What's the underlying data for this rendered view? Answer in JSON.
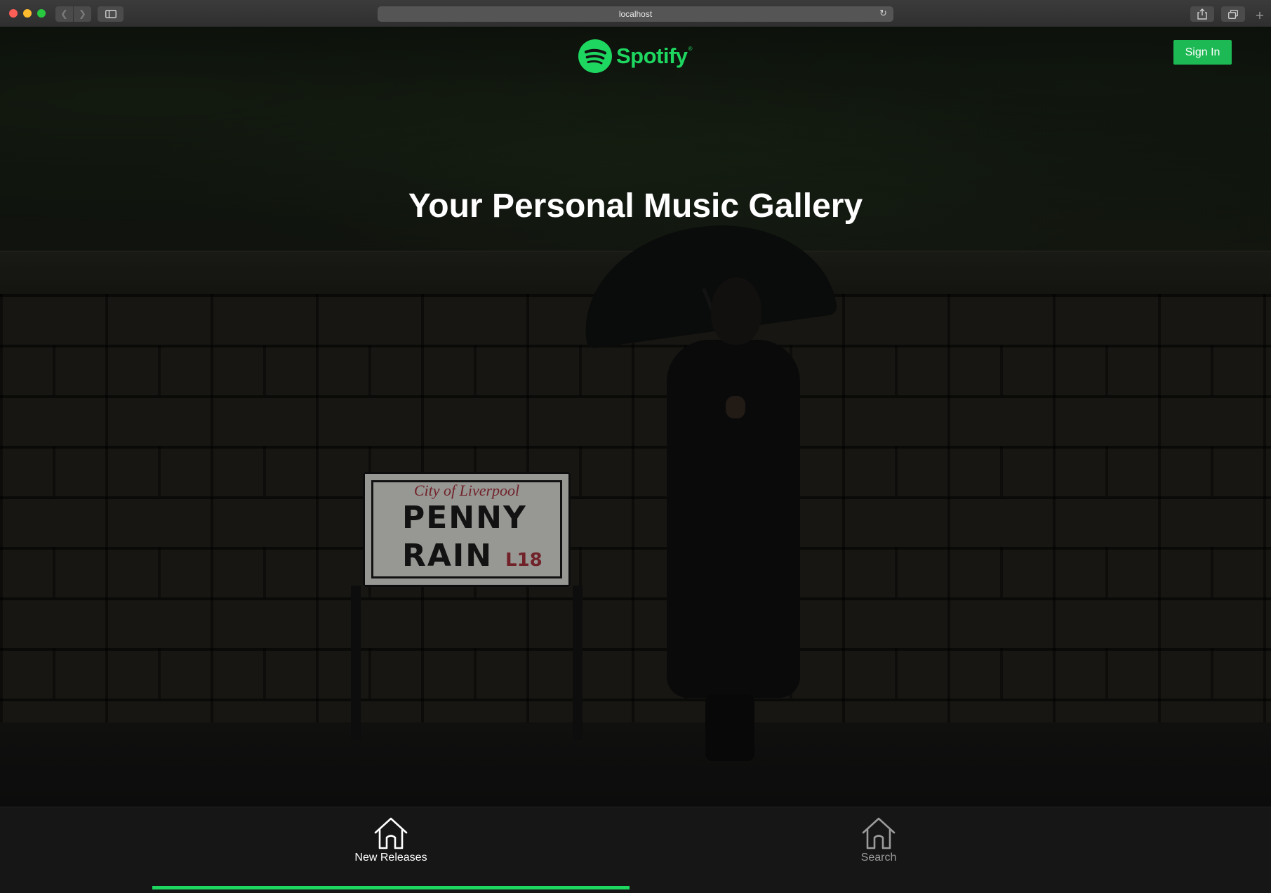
{
  "browser": {
    "url": "localhost",
    "new_tab_glyph": "+",
    "icons": [
      "back-arrow-icon",
      "forward-arrow-icon",
      "sidebar-icon",
      "reload-icon",
      "share-icon",
      "tabs-icon",
      "new-tab-icon"
    ]
  },
  "header": {
    "brand_name": "Spotify",
    "brand_mark": "®",
    "brand_color": "#1ed760",
    "signin_label": "Sign In",
    "signin_color": "#1db954"
  },
  "hero": {
    "title": "Your Personal Music Gallery",
    "sign": {
      "city": "City of Liverpool",
      "line1": "PENNY",
      "line2": "RAIN",
      "code": "L18"
    }
  },
  "nav": {
    "tabs": [
      {
        "label": "New Releases",
        "icon": "home-icon",
        "active": true
      },
      {
        "label": "Search",
        "icon": "home-icon",
        "active": false
      }
    ],
    "active_color": "#1ed760"
  }
}
